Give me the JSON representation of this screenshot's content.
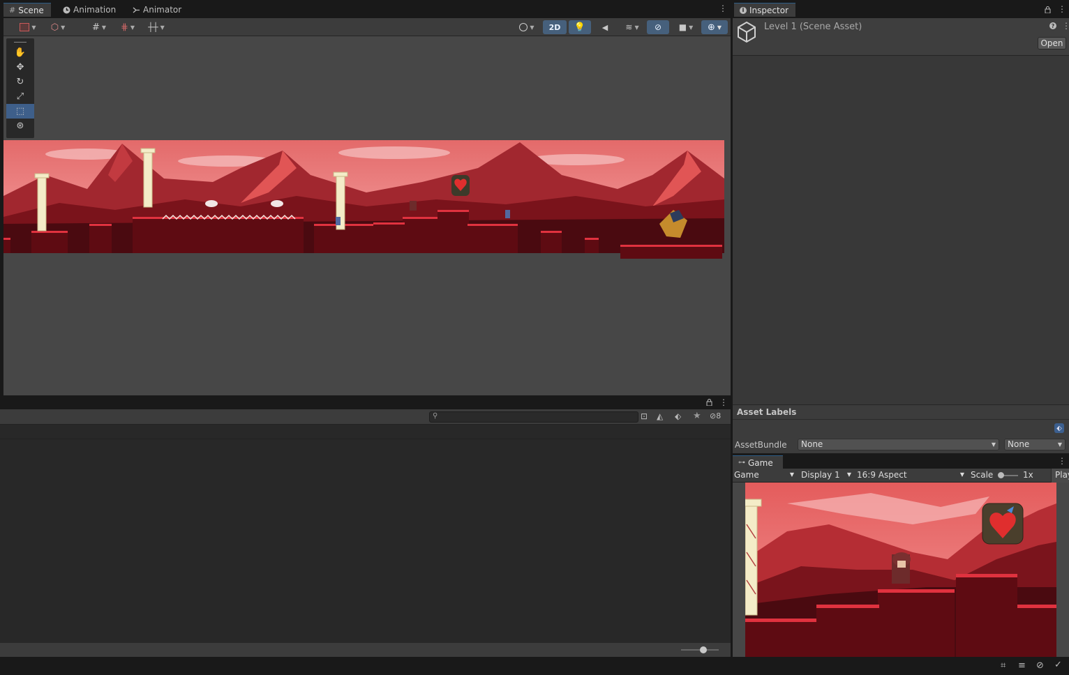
{
  "scene_panel": {
    "tabs": [
      {
        "label": "Scene",
        "icon": "hash-grid-icon"
      },
      {
        "label": "Animation",
        "icon": "clock-icon"
      },
      {
        "label": "Animator",
        "icon": "animator-icon"
      }
    ],
    "mode_2d_label": "2D"
  },
  "inspector": {
    "tab_label": "Inspector",
    "title": "Level 1 (Scene Asset)",
    "open_button": "Open",
    "asset_labels_header": "Asset Labels",
    "assetbundle_label": "AssetBundle",
    "assetbundle_value": "None",
    "assetbundle_variant": "None"
  },
  "project_panel": {
    "search_placeholder": "",
    "hidden_count": "8"
  },
  "game_panel": {
    "tab_label": "Game",
    "view_select": "Game",
    "display_select": "Display 1",
    "aspect_select": "16:9 Aspect",
    "scale_label": "Scale",
    "scale_value": "1x",
    "play_label": "Play"
  },
  "colors": {
    "accent": "#3e5f8a",
    "sky": "#e87676",
    "mountain": "#8a1c24",
    "ground": "#5c0d14",
    "grass": "#d8303f"
  }
}
